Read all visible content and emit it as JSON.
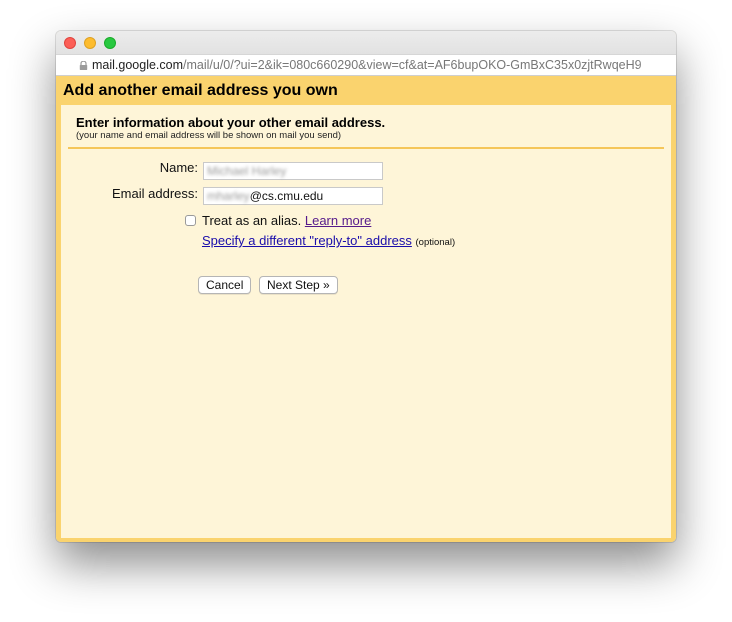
{
  "browser": {
    "url_host": "mail.google.com",
    "url_path": "/mail/u/0/?ui=2&ik=080c660290&view=cf&at=AF6bupOKO-GmBxC35x0zjtRwqeH9"
  },
  "dialog": {
    "title": "Add another email address you own",
    "section_title": "Enter information about your other email address.",
    "section_subtitle": "(your name and email address will be shown on mail you send)",
    "name_label": "Name:",
    "name_value_blurred": "Michael Harley",
    "email_label": "Email address:",
    "email_value_blurred_prefix": "mharley",
    "email_value_domain": "@cs.cmu.edu",
    "alias_checkbox_checked": false,
    "alias_label": "Treat as an alias.",
    "learn_more_link": "Learn more",
    "reply_to_link": "Specify a different \"reply-to\" address",
    "optional_label": "(optional)",
    "cancel_button": "Cancel",
    "next_button": "Next Step »"
  },
  "colors": {
    "header_bg": "#fad36e",
    "content_bg": "#fef5d8",
    "divider": "#f5c659",
    "link": "#1a0dab",
    "visited_link": "#551a8b"
  }
}
